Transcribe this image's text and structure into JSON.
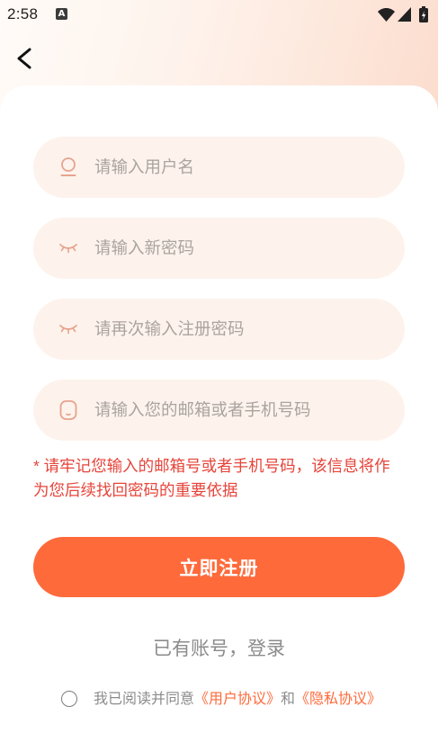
{
  "status_bar": {
    "time": "2:58",
    "notification_badge": "A",
    "icons": [
      "notification-a-icon",
      "wifi-icon",
      "signal-icon",
      "battery-charging-icon"
    ]
  },
  "header": {
    "back_icon": "chevron-left-icon"
  },
  "form": {
    "fields": [
      {
        "icon": "user-icon",
        "placeholder": "请输入用户名",
        "value": ""
      },
      {
        "icon": "eye-closed-icon",
        "placeholder": "请输入新密码",
        "value": ""
      },
      {
        "icon": "eye-closed-icon",
        "placeholder": "请再次输入注册密码",
        "value": ""
      },
      {
        "icon": "mobile-icon",
        "placeholder": "请输入您的邮箱或者手机号码",
        "value": ""
      }
    ],
    "notice_lines": [
      "* 请牢记您输入的邮箱号或者手机号码，该信息将作",
      "为您后续找回密码的重要依据"
    ],
    "submit_label": "立即注册"
  },
  "login_link": "已有账号，登录",
  "agreement": {
    "checked": false,
    "prefix": "我已阅读并同意",
    "user_agreement": "《用户协议》",
    "conjunction": "和",
    "privacy_agreement": "《隐私协议》"
  },
  "colors": {
    "accent": "#ff6a3b",
    "notice": "#e6443a",
    "field-bg": "#fdf3ec",
    "placeholder": "#aaa39f",
    "icon": "#e7a38e",
    "muted": "#8b8b8b"
  }
}
